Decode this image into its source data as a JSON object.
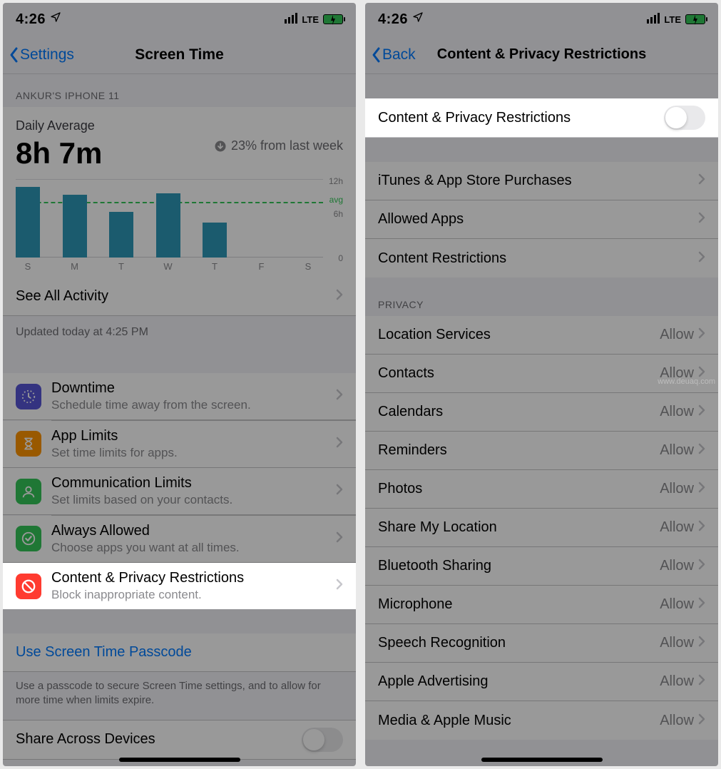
{
  "status": {
    "time": "4:26",
    "carrier": "LTE"
  },
  "left": {
    "nav": {
      "back": "Settings",
      "title": "Screen Time"
    },
    "device_header": "ANKUR'S IPHONE 11",
    "daily": {
      "label": "Daily Average",
      "value": "8h 7m",
      "trend": "23% from last week"
    },
    "see_all": "See All Activity",
    "updated": "Updated today at 4:25 PM",
    "items": [
      {
        "title": "Downtime",
        "sub": "Schedule time away from the screen.",
        "color": "#5856d6",
        "icon": "downtime"
      },
      {
        "title": "App Limits",
        "sub": "Set time limits for apps.",
        "color": "#ff9500",
        "icon": "hourglass"
      },
      {
        "title": "Communication Limits",
        "sub": "Set limits based on your contacts.",
        "color": "#34c759",
        "icon": "person"
      },
      {
        "title": "Always Allowed",
        "sub": "Choose apps you want at all times.",
        "color": "#34c759",
        "icon": "check"
      },
      {
        "title": "Content & Privacy Restrictions",
        "sub": "Block inappropriate content.",
        "color": "#ff3b30",
        "icon": "nosign"
      }
    ],
    "passcode_link": "Use Screen Time Passcode",
    "passcode_note": "Use a passcode to secure Screen Time settings, and to allow for more time when limits expire.",
    "share_label": "Share Across Devices"
  },
  "right": {
    "nav": {
      "back": "Back",
      "title": "Content & Privacy Restrictions"
    },
    "toggle_label": "Content & Privacy Restrictions",
    "section1": [
      "iTunes & App Store Purchases",
      "Allowed Apps",
      "Content Restrictions"
    ],
    "privacy_header": "PRIVACY",
    "privacy_items": [
      "Location Services",
      "Contacts",
      "Calendars",
      "Reminders",
      "Photos",
      "Share My Location",
      "Bluetooth Sharing",
      "Microphone",
      "Speech Recognition",
      "Apple Advertising",
      "Media & Apple Music"
    ],
    "allow": "Allow"
  },
  "chart_data": {
    "type": "bar",
    "categories": [
      "S",
      "M",
      "T",
      "W",
      "T",
      "F",
      "S"
    ],
    "values": [
      10.8,
      9.6,
      7.0,
      9.8,
      5.4,
      0,
      0
    ],
    "ylim": [
      0,
      12
    ],
    "avg": 8.1,
    "y_ticks": {
      "top": "12h",
      "mid": "6h",
      "zero": "0"
    },
    "avg_label": "avg"
  },
  "watermark": "www.deuaq.com"
}
